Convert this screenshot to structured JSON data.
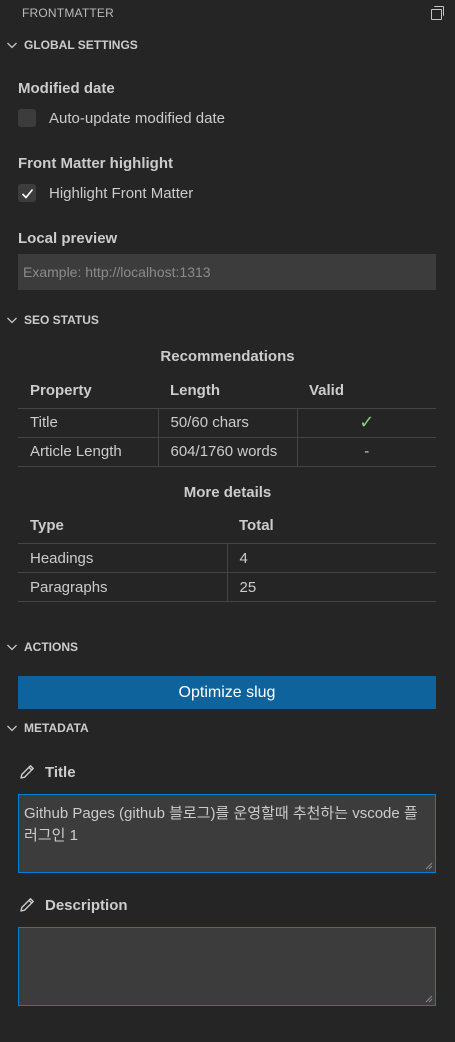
{
  "panel": {
    "title": "FRONTMATTER"
  },
  "global_settings": {
    "header": "GLOBAL SETTINGS",
    "modified_date": {
      "title": "Modified date",
      "checkbox_label": "Auto-update modified date",
      "checked": false
    },
    "highlight": {
      "title": "Front Matter highlight",
      "checkbox_label": "Highlight Front Matter",
      "checked": true
    },
    "local_preview": {
      "title": "Local preview",
      "placeholder": "Example: http://localhost:1313",
      "value": ""
    }
  },
  "seo_status": {
    "header": "SEO STATUS",
    "recommendations": {
      "title": "Recommendations",
      "columns": [
        "Property",
        "Length",
        "Valid"
      ],
      "rows": [
        {
          "property": "Title",
          "length": "50/60 chars",
          "valid": "✓"
        },
        {
          "property": "Article Length",
          "length": "604/1760 words",
          "valid": "-"
        }
      ]
    },
    "details": {
      "title": "More details",
      "columns": [
        "Type",
        "Total"
      ],
      "rows": [
        {
          "type": "Headings",
          "total": "4"
        },
        {
          "type": "Paragraphs",
          "total": "25"
        }
      ]
    }
  },
  "actions": {
    "header": "ACTIONS",
    "optimize_slug_label": "Optimize slug"
  },
  "metadata": {
    "header": "METADATA",
    "title_label": "Title",
    "title_value": "Github Pages (github 블로그)를 운영할때 추천하는 vscode 플러그인 1",
    "description_label": "Description",
    "description_value": ""
  },
  "colors": {
    "background": "#252526",
    "input_background": "#3c3c3c",
    "button": "#0e639c",
    "focus_border": "#007fd4",
    "valid_check": "#89d185"
  }
}
